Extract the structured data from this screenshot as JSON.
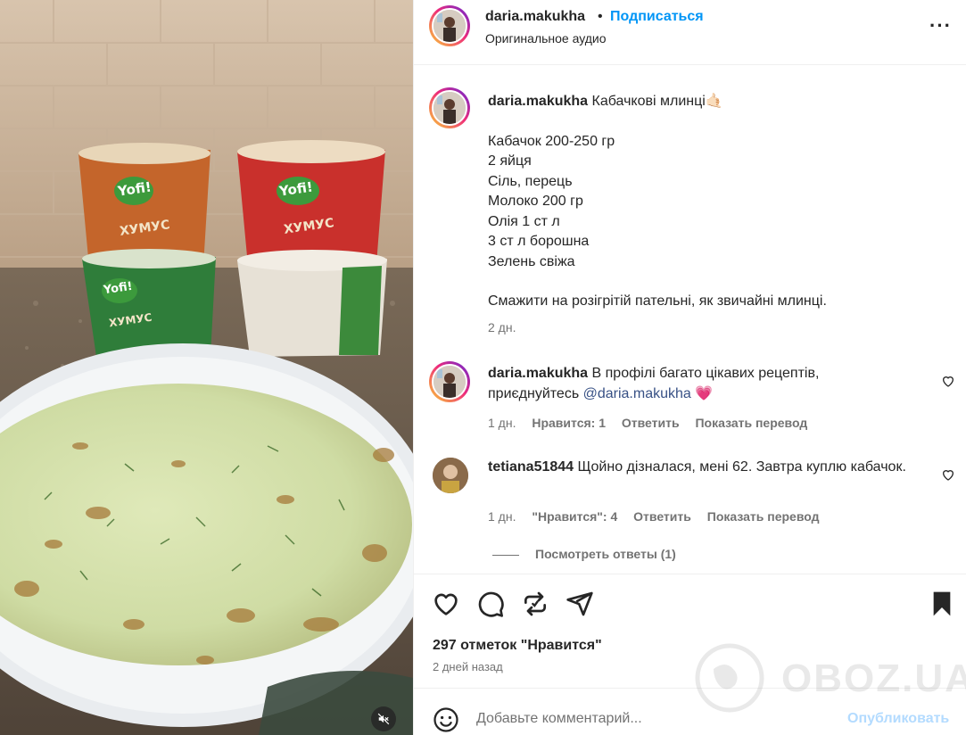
{
  "post_author": {
    "username": "daria.makukha",
    "follow_label": "Подписаться",
    "dot": "•",
    "audio": "Оригинальное аудио",
    "more_icon": "more-horizontal-icon"
  },
  "media": {
    "brand_text": "Yofi!",
    "product_text": "ХУМУС",
    "mute_icon": "muted-speaker-icon"
  },
  "caption": {
    "username": "daria.makukha",
    "title": "Кабачкові млинці🤙🏻",
    "lines": [
      "Кабачок 200-250 гр",
      "2 яйця",
      "Сіль, перець",
      "Молоко 200 гр",
      "Олія 1 ст л",
      "3 ст л борошна",
      "Зелень свіжа"
    ],
    "instruction": "Смажити на розігрітій пательні, як звичайні млинці.",
    "time": "2 дн."
  },
  "comments": [
    {
      "username": "daria.makukha",
      "text": "В профілі багато цікавих рецептів, приєднуйтесь",
      "mention": "@daria.makukha",
      "emoji": "💗",
      "time": "1 дн.",
      "likes": "Нравится: 1",
      "reply": "Ответить",
      "translate": "Показать перевод"
    },
    {
      "username": "tetiana51844",
      "text": "Щойно дізналася, мені 62. Завтра куплю кабачок.",
      "time": "1 дн.",
      "likes": "\"Нравится\": 4",
      "reply": "Ответить",
      "translate": "Показать перевод"
    }
  ],
  "view_replies": "Посмотреть ответы (1)",
  "actions": {
    "like_icon": "heart-icon",
    "comment_icon": "comment-icon",
    "share_icon": "repost-icon",
    "send_icon": "send-icon",
    "save_icon": "bookmark-icon"
  },
  "likes_count": "297 отметок \"Нравится\"",
  "posted_ago": "2 дней назад",
  "comment_box": {
    "placeholder": "Добавьте комментарий...",
    "publish_label": "Опубликовать",
    "emoji_icon": "smiley-icon"
  },
  "watermark": "OBOZ.UA",
  "colors": {
    "link_blue": "#0095f6",
    "publish_disabled": "#b3dbff",
    "mention": "#385185",
    "heart_pink": "#ee3f8c"
  }
}
